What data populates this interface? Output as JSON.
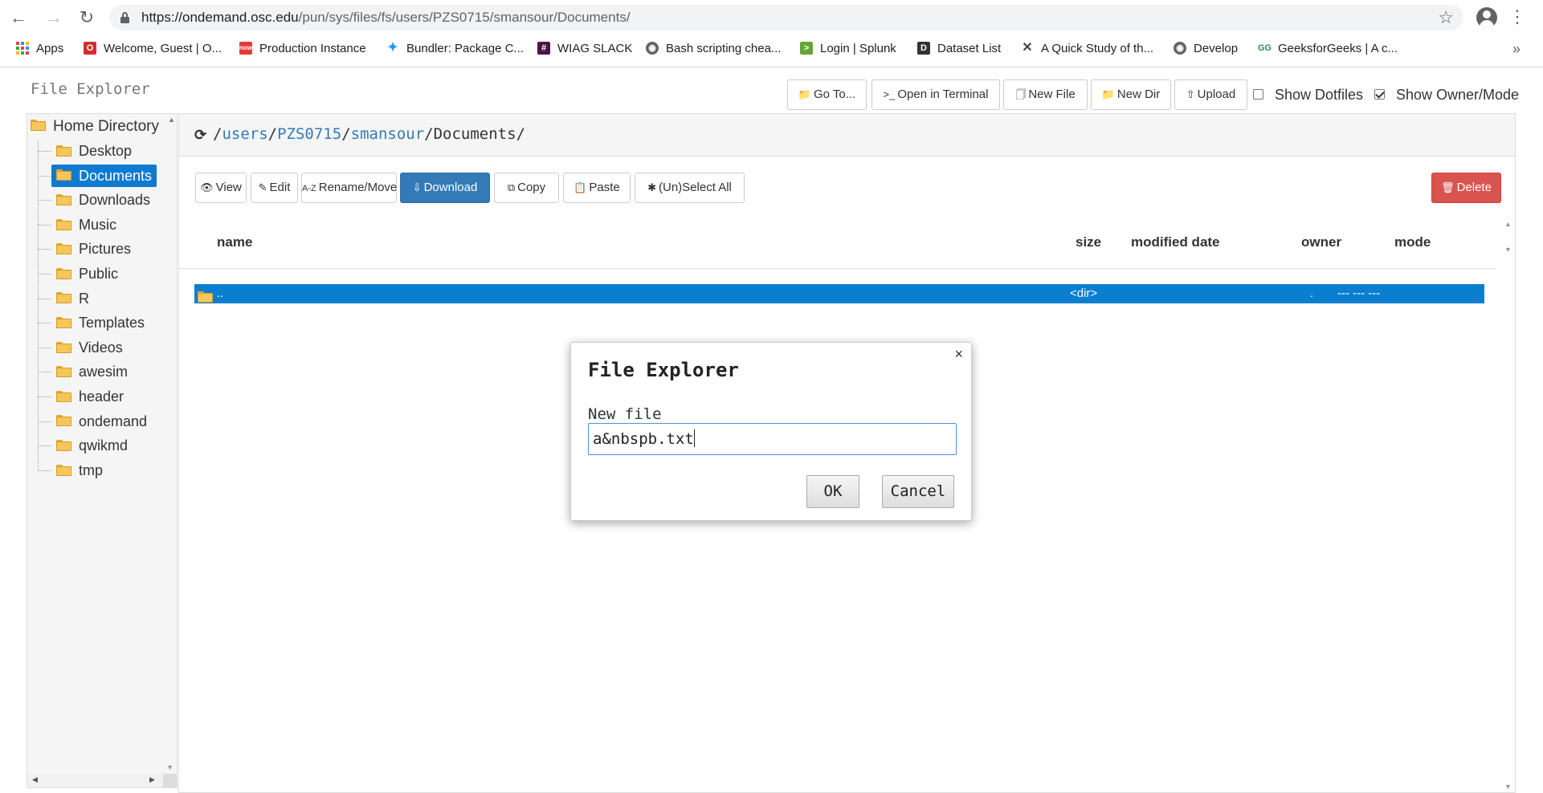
{
  "browser": {
    "url_host": "https://ondemand.osc.edu",
    "url_path": "/pun/sys/files/fs/users/PZS0715/smansour/Documents/",
    "bookmarks": [
      {
        "label": "Apps",
        "icon": "apps-grid-icon"
      },
      {
        "label": "Welcome, Guest | O...",
        "icon": "osc-tech-icon",
        "color": "#d32f2f"
      },
      {
        "label": "Production Instance",
        "icon": "servicenow-icon",
        "color": "#e53935"
      },
      {
        "label": "Bundler: Package C...",
        "icon": "bundler-icon",
        "color": "#2196f3"
      },
      {
        "label": "WIAG SLACK",
        "icon": "slack-icon",
        "color": "#4a154b"
      },
      {
        "label": "Bash scripting chea...",
        "icon": "globe-icon",
        "color": "#5f6368"
      },
      {
        "label": "Login | Splunk",
        "icon": "splunk-icon",
        "color": "#65a637"
      },
      {
        "label": "Dataset List",
        "icon": "dataset-icon",
        "color": "#333333"
      },
      {
        "label": "A Quick Study of th...",
        "icon": "git-icon",
        "color": "#444444"
      },
      {
        "label": "Develop",
        "icon": "globe-icon",
        "color": "#5f6368"
      },
      {
        "label": "GeeksforGeeks | A c...",
        "icon": "gfg-icon",
        "color": "#2f8d46"
      }
    ],
    "more": "»"
  },
  "app": {
    "title": "File Explorer",
    "toolbar": {
      "goto": "Go To...",
      "terminal": "Open in Terminal",
      "new_file": "New File",
      "new_dir": "New Dir",
      "upload": "Upload",
      "show_dotfiles": "Show Dotfiles",
      "show_dotfiles_checked": false,
      "show_owner_mode": "Show Owner/Mode",
      "show_owner_mode_checked": true
    }
  },
  "tree": {
    "root": "Home Directory",
    "items": [
      "Desktop",
      "Documents",
      "Downloads",
      "Music",
      "Pictures",
      "Public",
      "R",
      "Templates",
      "Videos",
      "awesim",
      "header",
      "ondemand",
      "qwikmd",
      "tmp"
    ],
    "selected": "Documents"
  },
  "path": {
    "segments": [
      "users",
      "PZS0715",
      "smansour"
    ],
    "current": "Documents",
    "sep": "/"
  },
  "actions": {
    "view": "View",
    "edit": "Edit",
    "rename": "Rename/Move",
    "download": "Download",
    "copy": "Copy",
    "paste": "Paste",
    "select_all": "(Un)Select All",
    "delete": "Delete"
  },
  "table": {
    "headers": {
      "name": "name",
      "size": "size",
      "modified": "modified date",
      "owner": "owner",
      "mode": "mode"
    },
    "rows": [
      {
        "name": "..",
        "size": "<dir>",
        "modified": "",
        "owner": ".",
        "mode": "--- --- ---"
      }
    ]
  },
  "modal": {
    "title": "File Explorer",
    "label": "New file",
    "value": "a&nbspb.txt",
    "ok": "OK",
    "cancel": "Cancel",
    "close": "×"
  },
  "colors": {
    "primary": "#337ab7",
    "selection": "#0a7fd0",
    "danger": "#d9534f"
  }
}
